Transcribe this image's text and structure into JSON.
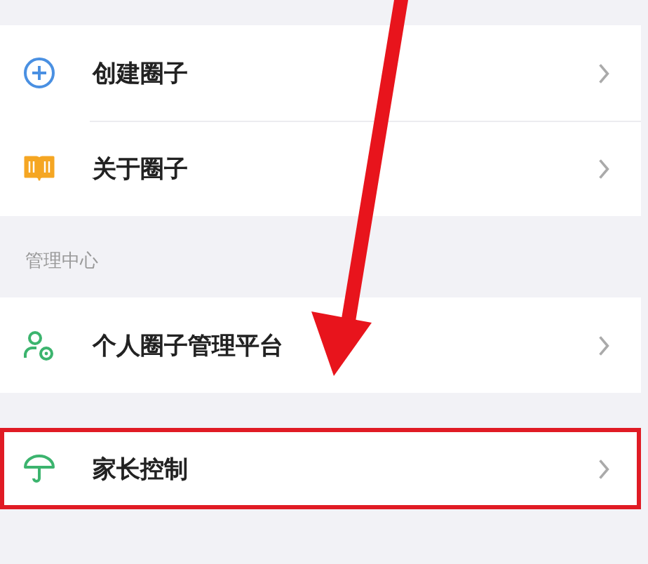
{
  "groups": [
    {
      "items": [
        {
          "label": "创建圈子",
          "highlighted": false
        },
        {
          "label": "关于圈子",
          "highlighted": false
        }
      ]
    },
    {
      "heading": "管理中心",
      "items": [
        {
          "label": "个人圈子管理平台",
          "highlighted": false
        }
      ]
    },
    {
      "items": [
        {
          "label": "家长控制",
          "highlighted": true
        }
      ]
    }
  ]
}
